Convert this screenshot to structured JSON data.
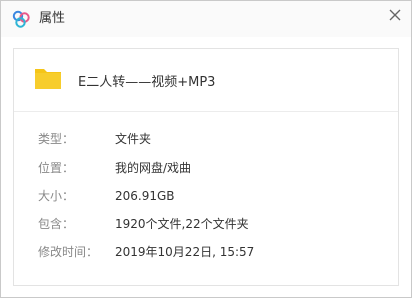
{
  "window": {
    "title": "属性",
    "close_glyph": "✕"
  },
  "file": {
    "name": "E二人转——视频+MP3",
    "icon": "folder-icon"
  },
  "properties": [
    {
      "label": "类型：",
      "value": "文件夹"
    },
    {
      "label": "位置：",
      "value": "我的网盘/戏曲"
    },
    {
      "label": "大小：",
      "value": "206.91GB"
    },
    {
      "label": "包含：",
      "value": "1920个文件,22个文件夹"
    },
    {
      "label": "修改时间：",
      "value": "2019年10月22日, 15:57"
    }
  ],
  "colors": {
    "folder": "#f5c518",
    "logo_blue": "#3a86e0",
    "logo_pink": "#e85a8a",
    "logo_cyan": "#2fb5d6"
  }
}
